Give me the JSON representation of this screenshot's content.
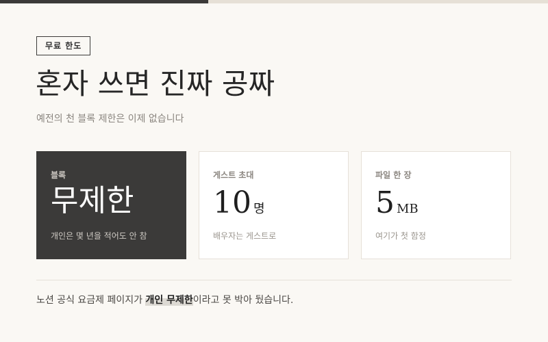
{
  "progress": {
    "value": 0.38
  },
  "badge": "무료 한도",
  "title": "혼자 쓰면 진짜 공짜",
  "subtitle": "예전의 천 블록 제한은 이제 없습니다",
  "cards": [
    {
      "label": "블록",
      "value": "무제한",
      "unit": "",
      "note": "개인은 몇 년을 적어도 안 참"
    },
    {
      "label": "게스트 초대",
      "value": "10",
      "unit": "명",
      "note": "배우자는 게스트로"
    },
    {
      "label": "파일 한 장",
      "value": "5",
      "unit": "MB",
      "note": "여기가 첫 함정"
    }
  ],
  "footnote": {
    "before": "노션 공식 요금제 페이지가 ",
    "highlight": "개인 무제한",
    "after": "이라고 못 박아 뒀습니다."
  },
  "colors": {
    "background": "#faf8f4",
    "dark_card": "#3b3a39",
    "progress_fill": "#3b3a39",
    "progress_track": "#e6e0d6"
  }
}
